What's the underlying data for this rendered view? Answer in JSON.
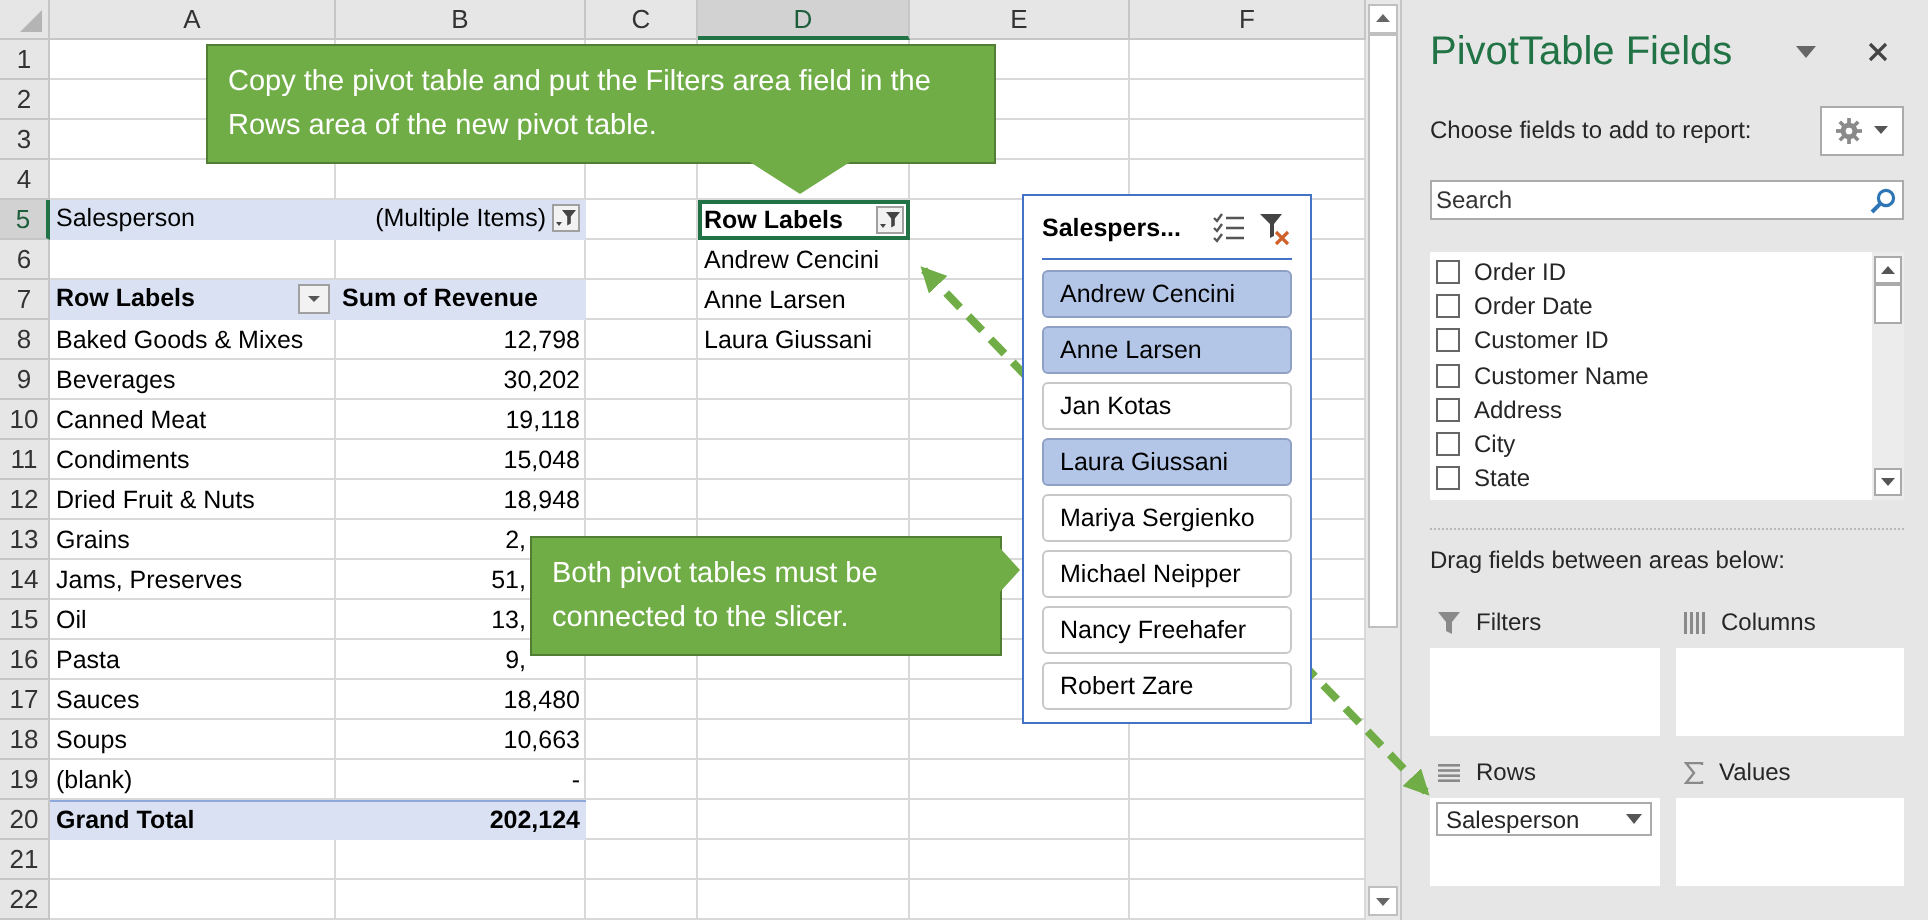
{
  "sheet": {
    "columns": [
      {
        "label": "A",
        "selected": false
      },
      {
        "label": "B",
        "selected": false
      },
      {
        "label": "C",
        "selected": false
      },
      {
        "label": "D",
        "selected": true
      },
      {
        "label": "E",
        "selected": false
      },
      {
        "label": "F",
        "selected": false
      }
    ],
    "rows": [
      {
        "number": "1",
        "selected": false
      },
      {
        "number": "2",
        "selected": false
      },
      {
        "number": "3",
        "selected": false
      },
      {
        "number": "4",
        "selected": false
      },
      {
        "number": "5",
        "selected": true,
        "kind": "filter",
        "a": "Salesperson",
        "b": "(Multiple Items)",
        "d": "Row Labels",
        "d_header": true
      },
      {
        "number": "6",
        "selected": false,
        "d": "Andrew Cencini"
      },
      {
        "number": "7",
        "selected": false,
        "kind": "header",
        "a": "Row Labels",
        "b": "Sum of Revenue",
        "d": "Anne Larsen"
      },
      {
        "number": "8",
        "selected": false,
        "kind": "item",
        "a": "Baked Goods & Mixes",
        "b": "12,798",
        "d": "Laura Giussani"
      },
      {
        "number": "9",
        "selected": false,
        "kind": "item",
        "a": "Beverages",
        "b": "30,202"
      },
      {
        "number": "10",
        "selected": false,
        "kind": "item",
        "a": "Canned Meat",
        "b": "19,118"
      },
      {
        "number": "11",
        "selected": false,
        "kind": "item",
        "a": "Condiments",
        "b": "15,048"
      },
      {
        "number": "12",
        "selected": false,
        "kind": "item",
        "a": "Dried Fruit & Nuts",
        "b": "18,948"
      },
      {
        "number": "13",
        "selected": false,
        "kind": "item",
        "a": "Grains",
        "b": "2,",
        "covered": true
      },
      {
        "number": "14",
        "selected": false,
        "kind": "item",
        "a": "Jams, Preserves",
        "b": "51,",
        "covered": true
      },
      {
        "number": "15",
        "selected": false,
        "kind": "item",
        "a": "Oil",
        "b": "13,",
        "covered": true
      },
      {
        "number": "16",
        "selected": false,
        "kind": "item",
        "a": "Pasta",
        "b": "9,",
        "covered": true
      },
      {
        "number": "17",
        "selected": false,
        "kind": "item",
        "a": "Sauces",
        "b": "18,480"
      },
      {
        "number": "18",
        "selected": false,
        "kind": "item",
        "a": "Soups",
        "b": "10,663"
      },
      {
        "number": "19",
        "selected": false,
        "kind": "item",
        "a": "(blank)",
        "b": "-"
      },
      {
        "number": "20",
        "selected": false,
        "kind": "total",
        "a": "Grand Total",
        "b": "202,124"
      },
      {
        "number": "21",
        "selected": false
      },
      {
        "number": "22",
        "selected": false
      }
    ]
  },
  "callouts": [
    {
      "text": "Copy the pivot table and put the Filters area field in the Rows area of the new pivot table.",
      "kind": "bottom"
    },
    {
      "text": "Both pivot tables must be connected to the slicer.",
      "kind": "right"
    }
  ],
  "slicer": {
    "title": "Salespers...",
    "items": [
      {
        "label": "Andrew Cencini",
        "selected": true
      },
      {
        "label": "Anne Larsen",
        "selected": true
      },
      {
        "label": "Jan Kotas",
        "selected": false
      },
      {
        "label": "Laura Giussani",
        "selected": true
      },
      {
        "label": "Mariya Sergienko",
        "selected": false
      },
      {
        "label": "Michael Neipper",
        "selected": false
      },
      {
        "label": "Nancy Freehafer",
        "selected": false
      },
      {
        "label": "Robert Zare",
        "selected": false
      }
    ]
  },
  "pane": {
    "title": "PivotTable Fields",
    "subtitle": "Choose fields to add to report:",
    "search": {
      "placeholder": "Search"
    },
    "fields": [
      {
        "label": "Order ID",
        "checked": false
      },
      {
        "label": "Order Date",
        "checked": false
      },
      {
        "label": "Customer ID",
        "checked": false
      },
      {
        "label": "Customer Name",
        "checked": false
      },
      {
        "label": "Address",
        "checked": false
      },
      {
        "label": "City",
        "checked": false
      },
      {
        "label": "State",
        "checked": false
      }
    ],
    "areas_hint": "Drag fields between areas below:",
    "areas": [
      {
        "kind": "filters",
        "label": "Filters"
      },
      {
        "kind": "columns",
        "label": "Columns"
      },
      {
        "kind": "rows",
        "label": "Rows",
        "items": [
          "Salesperson"
        ]
      },
      {
        "kind": "values",
        "label": "Values"
      }
    ]
  }
}
